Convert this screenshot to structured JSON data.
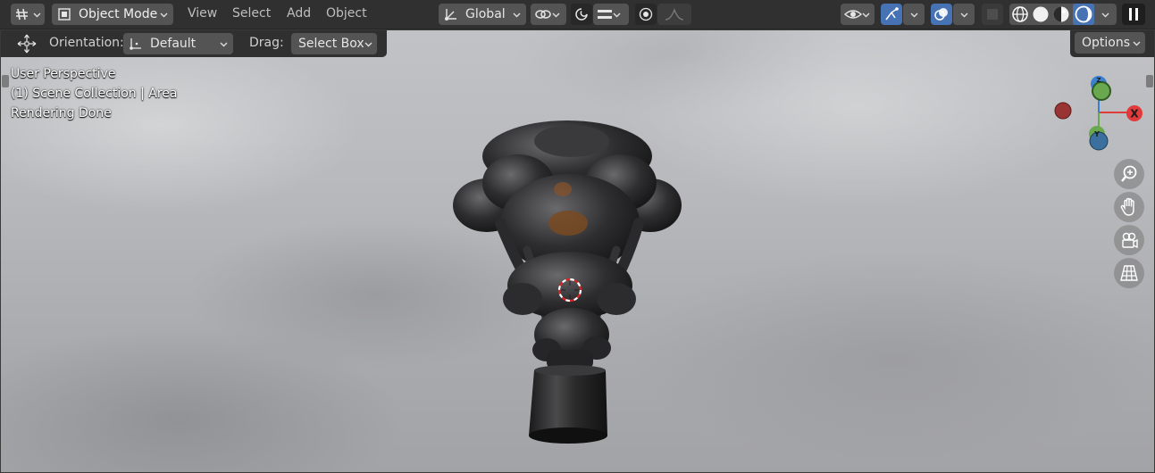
{
  "header": {
    "editor_type_icon": "grid-editor-icon",
    "mode_label": "Object Mode",
    "menus": [
      "View",
      "Select",
      "Add",
      "Object"
    ],
    "transform_orientation": "Global",
    "right_icons": [
      "visibility-eye-icon",
      "gizmo-icon",
      "overlay-icon",
      "xray-icon",
      "wireframe-shading-icon",
      "solid-shading-icon",
      "material-shading-icon",
      "rendered-shading-icon",
      "pause-icon"
    ]
  },
  "tool_settings": {
    "orientation_label": "Orientation:",
    "orientation_value": "Default",
    "drag_label": "Drag:",
    "drag_value": "Select Box",
    "options_label": "Options"
  },
  "viewport_info": {
    "line1": "User Perspective",
    "line2": "(1) Scene Collection | Area",
    "line3": "Rendering Done"
  },
  "gizmo": {
    "x_label": "X",
    "y_label": "Y",
    "z_label": "Z",
    "x_color": "#e03a3a",
    "y_color": "#6aa84f",
    "z_color": "#3a7fd0"
  },
  "nav_buttons": [
    "zoom-icon",
    "hand-pan-icon",
    "camera-icon",
    "grid-perspective-icon"
  ],
  "colors": {
    "header_bg": "#303030",
    "button_bg": "#545454",
    "active_blue": "#4772b3"
  }
}
